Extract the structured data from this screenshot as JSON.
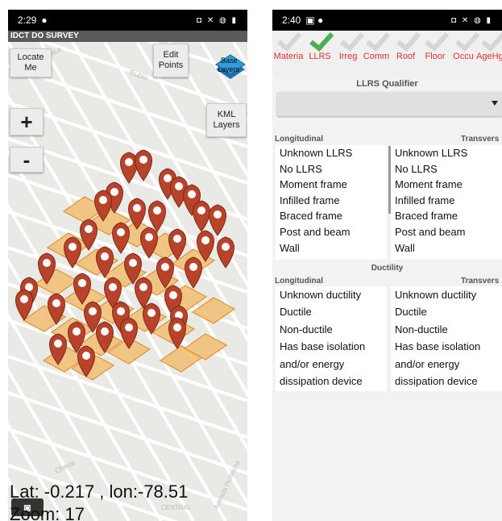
{
  "left_screen": {
    "status": {
      "time": "2:29",
      "icons": "◘ ✕ ◍ ▮"
    },
    "app_title": "IDCT DO SURVEY",
    "buttons": {
      "locate_line1": "Locate",
      "locate_line2": "Me",
      "edit_line1": "Edit",
      "edit_line2": "Points",
      "zoom_in": "+",
      "zoom_out": "-",
      "kml_line1": "KML",
      "kml_line2": "Layers",
      "base_line1": "Base",
      "base_line2": "Layers"
    },
    "coords": "Lat: -0.217 , lon:-78.51",
    "zoom": "Zoom: 17",
    "street_labels": [
      "Cuenca",
      "Rubio",
      "Checa",
      "CENTRAL",
      "Avenida Pichincha"
    ],
    "colors": {
      "pin": "#b8432a",
      "building_fill": "#f1c27a",
      "building_stroke": "#e08a1e"
    }
  },
  "right_screen": {
    "status": {
      "time": "2:40",
      "icons": "◘ ✕ ◍ ▮"
    },
    "tabs": [
      {
        "label": "Materia"
      },
      {
        "label": "LLRS",
        "active": true
      },
      {
        "label": "Irreg"
      },
      {
        "label": "Comm"
      },
      {
        "label": "Roof"
      },
      {
        "label": "Floor"
      },
      {
        "label": "Occu"
      },
      {
        "label": "AgeHg"
      }
    ],
    "llrs_qualifier": "LLRS Qualifier",
    "headers": {
      "longitudinal": "Longitudinal",
      "transverse": "Transvers"
    },
    "llrs_longitudinal": [
      "Unknown LLRS",
      "No LLRS",
      "Moment frame",
      "Infilled frame",
      "Braced frame",
      "Post and beam",
      "Wall"
    ],
    "llrs_transverse": [
      "Unknown LLRS",
      "No LLRS",
      "Moment frame",
      "Infilled frame",
      "Braced frame",
      "Post and beam",
      "Wall"
    ],
    "ductility_title": "Ductility",
    "ductility_longitudinal": [
      "Unknown ductility",
      "Ductile",
      "Non-ductile",
      "Has base isolation",
      "and/or energy",
      "dissipation device"
    ],
    "ductility_transverse": [
      "Unknown ductility",
      "Ductile",
      "Non-ductile",
      "Has base isolation",
      "and/or energy",
      "dissipation device"
    ],
    "colors": {
      "tab_label": "#e52a2a",
      "tick": "#4caf50"
    }
  }
}
